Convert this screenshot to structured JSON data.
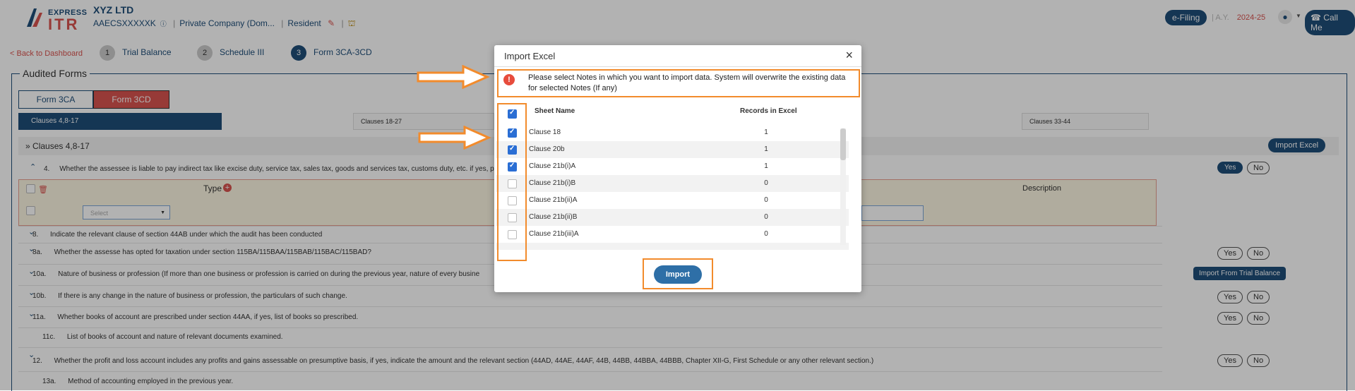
{
  "header": {
    "logo_express": "EXPRESS",
    "logo_itr": "ITR",
    "company": "XYZ LTD",
    "pan": "AAECSXXXXXK",
    "company_type": "Private Company (Dom...",
    "residency": "Resident",
    "efiling": "e-Filing",
    "ay_label": "A.Y.",
    "ay_value": "2024-25",
    "call_me": "Call Me"
  },
  "steps": {
    "back": "< Back to Dashboard",
    "items": [
      {
        "num": "1",
        "label": "Trial Balance"
      },
      {
        "num": "2",
        "label": "Schedule III"
      },
      {
        "num": "3",
        "label": "Form 3CA-3CD"
      }
    ]
  },
  "form": {
    "legend": "Audited Forms",
    "tab_3ca": "Form 3CA",
    "tab_3cd": "Form 3CD",
    "clause_tabs": [
      "Clauses 4,8-17",
      "Clauses 18-27",
      "Clauses 33-44"
    ],
    "section": "Clauses 4,8-17",
    "import_excel": "Import Excel",
    "import_tb": "Import From Trial Balance",
    "clause4_text": "Whether the assessee is liable to pay indirect tax like excise duty, service tax, sales tax, goods and services tax, customs duty, etc. if yes, p",
    "type_label": "Type",
    "description_label": "Description",
    "select_placeholder": "Select",
    "yes": "Yes",
    "no": "No",
    "rows": [
      {
        "num": "8.",
        "text": "Indicate the relevant clause of section 44AB under which the audit has been conducted"
      },
      {
        "num": "8a.",
        "text": "Whether the assesse has opted for taxation under section 115BA/115BAA/115BAB/115BAC/115BAD?"
      },
      {
        "num": "10a.",
        "text": "Nature of business or profession (If more than one business or profession is carried on during the previous year, nature of every busine"
      },
      {
        "num": "10b.",
        "text": "If there is any change in the nature of business or profession, the particulars of such change."
      },
      {
        "num": "11a.",
        "text": "Whether books of account are prescribed under section 44AA, if yes, list of books so prescribed."
      },
      {
        "num": "11c.",
        "text": "List of books of account and nature of relevant documents examined."
      },
      {
        "num": "12.",
        "text": "Whether the profit and loss account includes any profits and gains assessable on presumptive basis, if yes, indicate the amount and the relevant section (44AD, 44AE, 44AF, 44B, 44BB, 44BBA, 44BBB, Chapter XII-G, First Schedule or any other relevant section.)"
      },
      {
        "num": "13a.",
        "text": "Method of accounting employed in the previous year."
      }
    ]
  },
  "modal": {
    "title": "Import Excel",
    "close": "×",
    "warning": "Please select Notes in which you want to import data. System will overwrite the existing data for selected Notes (If any)",
    "col_sheet": "Sheet Name",
    "col_records": "Records in Excel",
    "rows": [
      {
        "name": "Clause 18",
        "count": "1",
        "checked": true
      },
      {
        "name": "Clause 20b",
        "count": "1",
        "checked": true
      },
      {
        "name": "Clause 21b(i)A",
        "count": "1",
        "checked": true
      },
      {
        "name": "Clause 21b(i)B",
        "count": "0",
        "checked": false
      },
      {
        "name": "Clause 21b(ii)A",
        "count": "0",
        "checked": false
      },
      {
        "name": "Clause 21b(ii)B",
        "count": "0",
        "checked": false
      },
      {
        "name": "Clause 21b(iii)A",
        "count": "0",
        "checked": false
      }
    ],
    "import_button": "Import"
  },
  "colors": {
    "brand": "#1f4e79",
    "accent_red": "#d9534f",
    "highlight": "#f28b2c",
    "import_btn": "#2e6fa7"
  }
}
